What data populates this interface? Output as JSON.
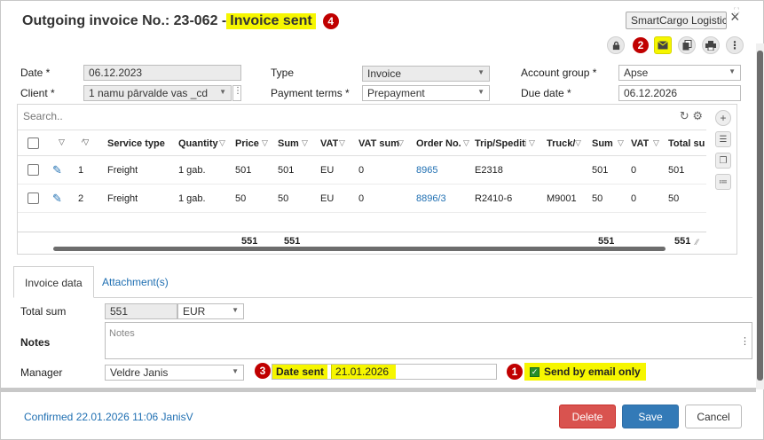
{
  "dialog": {
    "title_prefix": "Outgoing invoice No.: 23-062 - ",
    "title_status": "Invoice sent",
    "badge_status": "4",
    "company": "SmartCargo Logistics",
    "close_label": "×",
    "toolbar_badge": "2"
  },
  "form": {
    "date_label": "Date *",
    "date_value": "06.12.2023",
    "client_label": "Client *",
    "client_value": "1 namu pārvalde vas _cd",
    "type_label": "Type",
    "type_value": "Invoice",
    "payment_terms_label": "Payment terms *",
    "payment_terms_value": "Prepayment",
    "account_group_label": "Account group *",
    "account_group_value": "Apse",
    "due_date_label": "Due date *",
    "due_date_value": "06.12.2026"
  },
  "grid": {
    "search_placeholder": "Search..",
    "columns": [
      "Service type",
      "Quantity",
      "Price",
      "Sum",
      "VAT",
      "VAT sum",
      "Order No.",
      "Trip/Speditior",
      "Truck/",
      "Sum",
      "VAT",
      "Total sum"
    ],
    "rows": [
      {
        "n": "1",
        "service": "Freight",
        "qty": "1 gab.",
        "price": "501",
        "sum": "501",
        "vat": "EU",
        "vatsum": "0",
        "order": "8965",
        "trip": "E2318",
        "truck": "",
        "sum2": "501",
        "vat2": "0",
        "total": "501"
      },
      {
        "n": "2",
        "service": "Freight",
        "qty": "1 gab.",
        "price": "50",
        "sum": "50",
        "vat": "EU",
        "vatsum": "0",
        "order": "8896/3",
        "trip": "R2410-6",
        "truck": "M9001",
        "sum2": "50",
        "vat2": "0",
        "total": "50"
      }
    ],
    "totals": {
      "price": "551",
      "sum": "551",
      "sum2": "551",
      "total": "551"
    }
  },
  "tabs": {
    "invoice_data": "Invoice data",
    "attachments": "Attachment(s)"
  },
  "invoice_data": {
    "total_sum_label": "Total sum",
    "total_sum_value": "551",
    "currency": "EUR",
    "notes_label": "Notes",
    "notes_placeholder": "Notes",
    "manager_label": "Manager",
    "manager_value": "Veldre Janis",
    "badge_datesent": "3",
    "date_sent_label": "Date sent",
    "date_sent_value": "21.01.2026",
    "badge_email": "1",
    "send_by_email_label": "Send by email only"
  },
  "footer": {
    "confirmed": "Confirmed 22.01.2026 11:06 JanisV",
    "delete": "Delete",
    "save": "Save",
    "cancel": "Cancel"
  },
  "colors": {
    "highlight": "#f6f600",
    "badge": "#c00000",
    "primary": "#337ab7",
    "danger": "#d9534f"
  }
}
